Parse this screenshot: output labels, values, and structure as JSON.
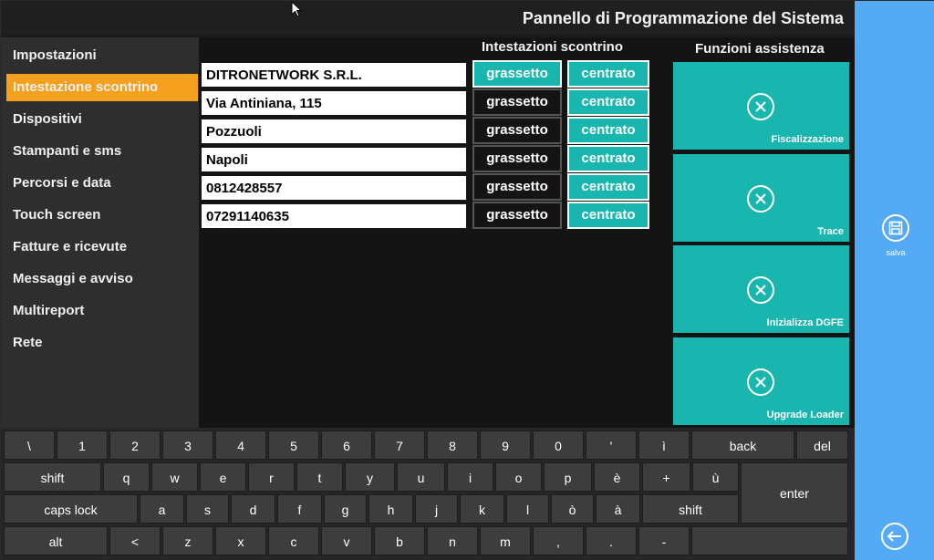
{
  "header": {
    "title": "Pannello di Programmazione del Sistema"
  },
  "menu": {
    "items": [
      {
        "label": "Impostazioni"
      },
      {
        "label": "Intestazione scontrino",
        "active": true
      },
      {
        "label": "Dispositivi"
      },
      {
        "label": "Stampanti e sms"
      },
      {
        "label": "Percorsi e data"
      },
      {
        "label": "Touch screen"
      },
      {
        "label": "Fatture e ricevute"
      },
      {
        "label": "Messaggi e avviso"
      },
      {
        "label": "Multireport"
      },
      {
        "label": "Rete"
      }
    ]
  },
  "receipt": {
    "title": "Intestazioni scontrino",
    "bold_label": "grassetto",
    "center_label": "centrato",
    "lines": [
      {
        "value": "DITRONETWORK S.R.L.",
        "bold": true
      },
      {
        "value": "Via Antiniana, 115",
        "bold": false
      },
      {
        "value": "Pozzuoli",
        "bold": false
      },
      {
        "value": "Napoli",
        "bold": false
      },
      {
        "value": "0812428557",
        "bold": false
      },
      {
        "value": "07291140635",
        "bold": false
      }
    ]
  },
  "service": {
    "title": "Funzioni assistenza",
    "tiles": [
      {
        "label": "Fiscalizzazione",
        "icon": "close-circle-icon"
      },
      {
        "label": "Trace",
        "icon": "close-circle-icon"
      },
      {
        "label": "Inizializza DGFE",
        "icon": "close-circle-icon"
      },
      {
        "label": "Upgrade Loader",
        "icon": "close-circle-icon"
      }
    ]
  },
  "sidebar": {
    "save_label": "salva"
  },
  "keyboard": {
    "rows": [
      [
        "\\",
        "1",
        "2",
        "3",
        "4",
        "5",
        "6",
        "7",
        "8",
        "9",
        "0",
        "'",
        "ì",
        "back",
        "del"
      ],
      [
        "shift",
        "q",
        "w",
        "e",
        "r",
        "t",
        "y",
        "u",
        "i",
        "o",
        "p",
        "è",
        "+",
        "ù",
        "enter"
      ],
      [
        "caps lock",
        "a",
        "s",
        "d",
        "f",
        "g",
        "h",
        "j",
        "k",
        "l",
        "ò",
        "à",
        "shift"
      ],
      [
        "alt",
        "<",
        "z",
        "x",
        "c",
        "v",
        "b",
        "n",
        "m",
        ",",
        ".",
        "-"
      ]
    ]
  },
  "colors": {
    "accent": "#19b6b0",
    "menu_active": "#f5a11f",
    "sidebar": "#55aaf5"
  }
}
